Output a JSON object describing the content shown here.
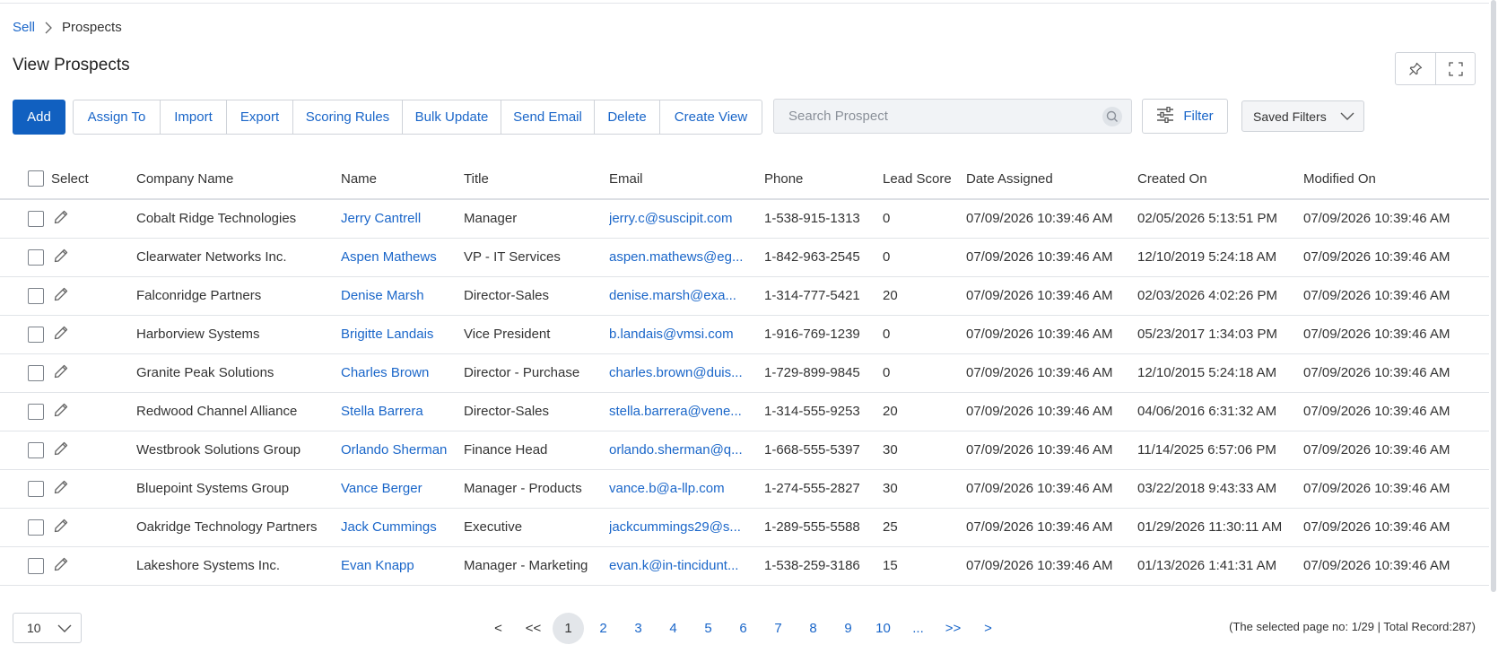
{
  "breadcrumb": {
    "parent": "Sell",
    "current": "Prospects"
  },
  "page_title": "View Prospects",
  "toolbar": {
    "add": "Add",
    "assign_to": "Assign To",
    "import": "Import",
    "export": "Export",
    "scoring_rules": "Scoring Rules",
    "bulk_update": "Bulk Update",
    "send_email": "Send Email",
    "delete": "Delete",
    "create_view": "Create View"
  },
  "search": {
    "placeholder": "Search Prospect",
    "value": ""
  },
  "filter_label": "Filter",
  "saved_filters_label": "Saved Filters",
  "table": {
    "headers": {
      "select": "Select",
      "company": "Company Name",
      "name": "Name",
      "title": "Title",
      "email": "Email",
      "phone": "Phone",
      "lead_score": "Lead Score",
      "date_assigned": "Date Assigned",
      "created_on": "Created On",
      "modified_on": "Modified On"
    },
    "rows": [
      {
        "company": "Cobalt Ridge Technologies",
        "name": "Jerry Cantrell",
        "title": "Manager",
        "email": "jerry.c@suscipit.com",
        "phone": "1-538-915-1313",
        "lead_score": "0",
        "date_assigned": "07/09/2026 10:39:46 AM",
        "created_on": "02/05/2026 5:13:51 PM",
        "modified_on": "07/09/2026 10:39:46 AM"
      },
      {
        "company": "Clearwater Networks Inc.",
        "name": "Aspen Mathews",
        "title": "VP - IT Services",
        "email": "aspen.mathews@eg...",
        "phone": "1-842-963-2545",
        "lead_score": "0",
        "date_assigned": "07/09/2026 10:39:46 AM",
        "created_on": "12/10/2019 5:24:18 AM",
        "modified_on": "07/09/2026 10:39:46 AM"
      },
      {
        "company": "Falconridge Partners",
        "name": "Denise Marsh",
        "title": "Director-Sales",
        "email": "denise.marsh@exa...",
        "phone": "1-314-777-5421",
        "lead_score": "20",
        "date_assigned": "07/09/2026 10:39:46 AM",
        "created_on": "02/03/2026 4:02:26 PM",
        "modified_on": "07/09/2026 10:39:46 AM"
      },
      {
        "company": "Harborview Systems",
        "name": "Brigitte Landais",
        "title": "Vice President",
        "email": "b.landais@vmsi.com",
        "phone": "1-916-769-1239",
        "lead_score": "0",
        "date_assigned": "07/09/2026 10:39:46 AM",
        "created_on": "05/23/2017 1:34:03 PM",
        "modified_on": "07/09/2026 10:39:46 AM"
      },
      {
        "company": "Granite Peak Solutions",
        "name": "Charles Brown",
        "title": "Director - Purchase",
        "email": "charles.brown@duis...",
        "phone": "1-729-899-9845",
        "lead_score": "0",
        "date_assigned": "07/09/2026 10:39:46 AM",
        "created_on": "12/10/2015 5:24:18 AM",
        "modified_on": "07/09/2026 10:39:46 AM"
      },
      {
        "company": "Redwood Channel Alliance",
        "name": "Stella Barrera",
        "title": "Director-Sales",
        "email": "stella.barrera@vene...",
        "phone": "1-314-555-9253",
        "lead_score": "20",
        "date_assigned": "07/09/2026 10:39:46 AM",
        "created_on": "04/06/2016 6:31:32 AM",
        "modified_on": "07/09/2026 10:39:46 AM"
      },
      {
        "company": "Westbrook Solutions Group",
        "name": "Orlando Sherman",
        "title": "Finance Head",
        "email": "orlando.sherman@q...",
        "phone": "1-668-555-5397",
        "lead_score": "30",
        "date_assigned": "07/09/2026 10:39:46 AM",
        "created_on": "11/14/2025 6:57:06 PM",
        "modified_on": "07/09/2026 10:39:46 AM"
      },
      {
        "company": "Bluepoint Systems Group",
        "name": "Vance Berger",
        "title": "Manager - Products",
        "email": "vance.b@a-llp.com",
        "phone": "1-274-555-2827",
        "lead_score": "30",
        "date_assigned": "07/09/2026 10:39:46 AM",
        "created_on": "03/22/2018 9:43:33 AM",
        "modified_on": "07/09/2026 10:39:46 AM"
      },
      {
        "company": "Oakridge Technology Partners",
        "name": "Jack Cummings",
        "title": "Executive",
        "email": "jackcummings29@s...",
        "phone": "1-289-555-5588",
        "lead_score": "25",
        "date_assigned": "07/09/2026 10:39:46 AM",
        "created_on": "01/29/2026 11:30:11 AM",
        "modified_on": "07/09/2026 10:39:46 AM"
      },
      {
        "company": "Lakeshore Systems Inc.",
        "name": "Evan Knapp",
        "title": "Manager - Marketing",
        "email": "evan.k@in-tincidunt...",
        "phone": "1-538-259-3186",
        "lead_score": "15",
        "date_assigned": "07/09/2026 10:39:46 AM",
        "created_on": "01/13/2026 1:41:31 AM",
        "modified_on": "07/09/2026 10:39:46 AM"
      }
    ]
  },
  "pagination": {
    "page_size": "10",
    "prev": "<",
    "first": "<<",
    "pages": [
      "1",
      "2",
      "3",
      "4",
      "5",
      "6",
      "7",
      "8",
      "9",
      "10"
    ],
    "current_page": "1",
    "ellipsis": "...",
    "last": ">>",
    "next": ">",
    "record_info": "(The selected page no: 1/29 | Total Record:287)"
  },
  "icons": {
    "pin": "pin-icon",
    "fullscreen": "fullscreen-icon",
    "search": "search-icon",
    "filter": "sliders-icon",
    "chevron": "chevron-down-icon",
    "edit": "pencil-icon",
    "breadcrumb_sep": "chevron-right-icon"
  },
  "colors": {
    "primary": "#1160c0",
    "link": "#1a66c9"
  }
}
